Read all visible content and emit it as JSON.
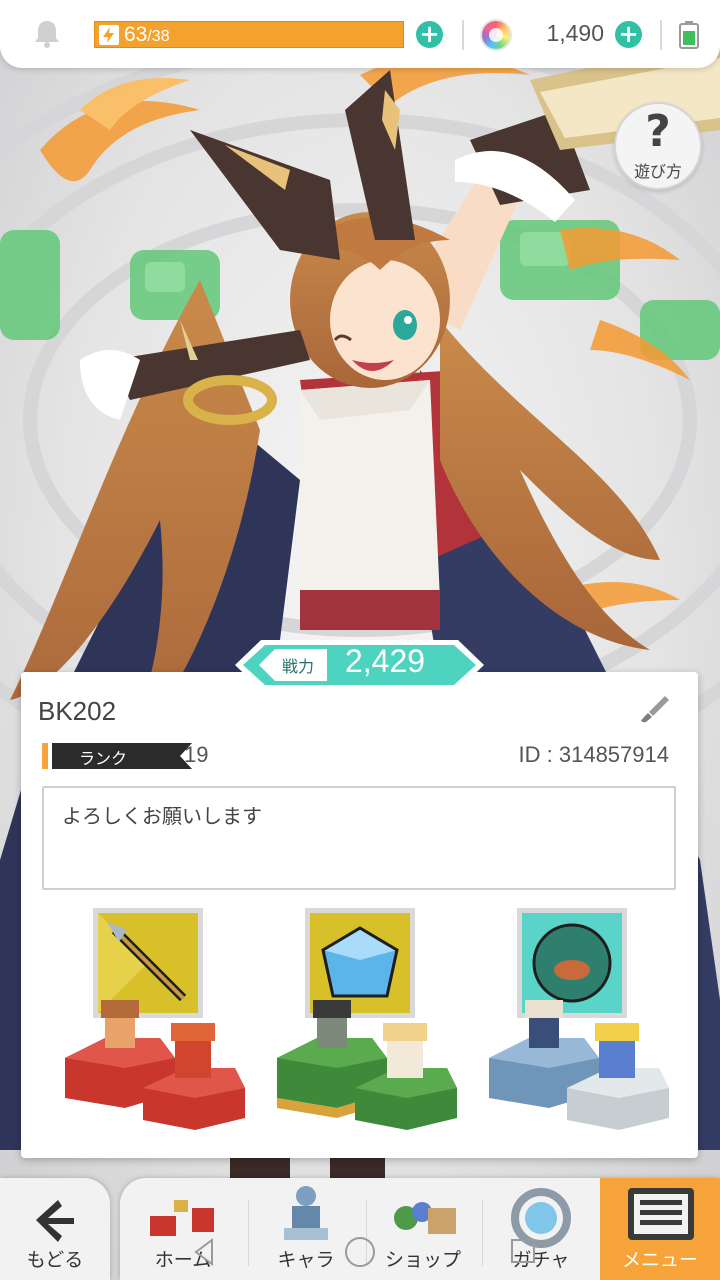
{
  "topbar": {
    "stamina_current": "63",
    "stamina_max": "/38",
    "stamina_fill": 1.0,
    "gems": "1,490"
  },
  "help": {
    "label": "遊び方"
  },
  "power": {
    "label": "戦力",
    "value": "2,429"
  },
  "profile": {
    "name": "BK202",
    "rank_label": "ランク",
    "rank_value": "19",
    "id_text": "ID : 314857914",
    "comment": "よろしくお願いします"
  },
  "nav": {
    "back": "もどる",
    "home": "ホーム",
    "chara": "キャラ",
    "shop": "ショップ",
    "gacha": "ガチャ",
    "menu": "メニュー",
    "active": "menu"
  },
  "colors": {
    "accent": "#2fc0a6",
    "stamina": "#f4a22e",
    "active_tab": "#f6a43a",
    "power_badge": "#4fd3c1"
  }
}
